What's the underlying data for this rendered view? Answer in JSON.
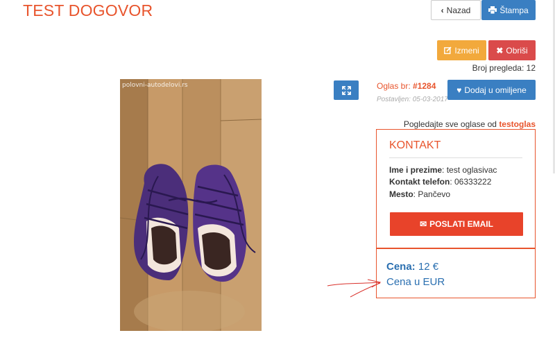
{
  "page_title": "TEST DOGOVOR",
  "toolbar": {
    "back_label": "Nazad",
    "print_label": "Štampa",
    "edit_label": "Izmeni",
    "delete_label": "Obriši"
  },
  "views": "Broj pregleda: 12",
  "photo": {
    "watermark": "polovni-autodelovi.rs"
  },
  "ad": {
    "number_label": "Oglas br: ",
    "number": "#1284",
    "posted": "Postavljen: 05-03-2017",
    "favorite_label": "Dodaj u omiljene"
  },
  "see_all": {
    "text": "Pogledajte sve oglase od ",
    "user": "testoglas"
  },
  "contact": {
    "heading": "KONTAKT",
    "name_label": "Ime i prezime",
    "name_value": ": test oglasivac",
    "phone_label": "Kontakt telefon",
    "phone_value": ": 06333222",
    "city_label": "Mesto",
    "city_value": ": Pančevo",
    "email_button": "POSLATI EMAIL"
  },
  "price": {
    "label": "Cena:",
    "value": " 12 €",
    "currency_link": "Cena u EUR"
  },
  "colors": {
    "accent": "#e8542c",
    "primary": "#3a7fc2",
    "warning": "#f2a93c",
    "danger": "#da4b4b"
  }
}
